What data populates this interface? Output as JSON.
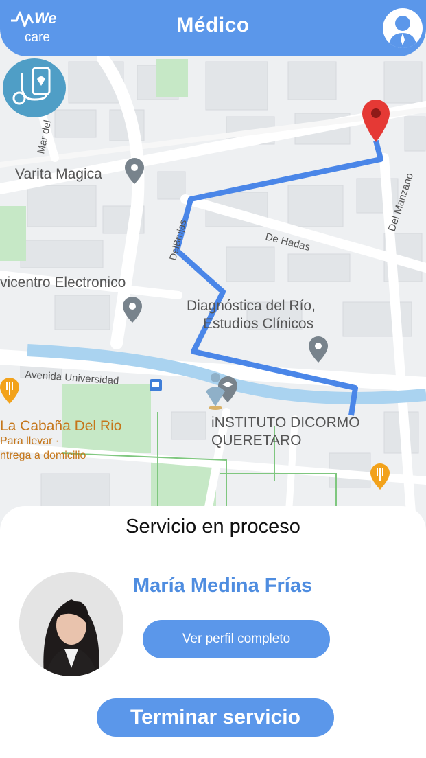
{
  "header": {
    "logo_main": "We",
    "logo_sub": "care",
    "title": "Médico"
  },
  "map": {
    "labels": {
      "mar_del": "Mar del",
      "varita": "Varita Magica",
      "del_brujas": "DelBrujas",
      "de_hadas": "De Hadas",
      "del_manzano": "Del Manzano",
      "centro": "vicentro Electronico",
      "diag1": "Diagnóstica del Río,",
      "diag2": "Estudios Clínicos",
      "avenida": "Avenida Universidad",
      "cabana": "La Cabaña Del Rio",
      "para_llevar": "Para llevar ·",
      "entrega": "ntrega a domicilio",
      "instituto1": "iNSTITUTO DICORMO",
      "instituto2": "QUERETARO"
    },
    "colors": {
      "route": "#4a86e8",
      "river": "#aad3f0",
      "park": "#c6e8c6",
      "destination_pin": "#e53935",
      "poi_pin": "#78838c",
      "food_pin": "#f2a21b"
    },
    "icons": [
      "destination-pin-icon",
      "place-pin-icon",
      "restaurant-icon",
      "bus-stop-icon",
      "school-icon",
      "stethoscope-icon"
    ]
  },
  "sheet": {
    "status": "Servicio en proceso",
    "doctor_name": "María Medina Frías",
    "profile_button": "Ver perfil completo",
    "end_button": "Terminar servicio"
  },
  "colors": {
    "primary": "#5b97ea",
    "name_text": "#4f8de0"
  }
}
